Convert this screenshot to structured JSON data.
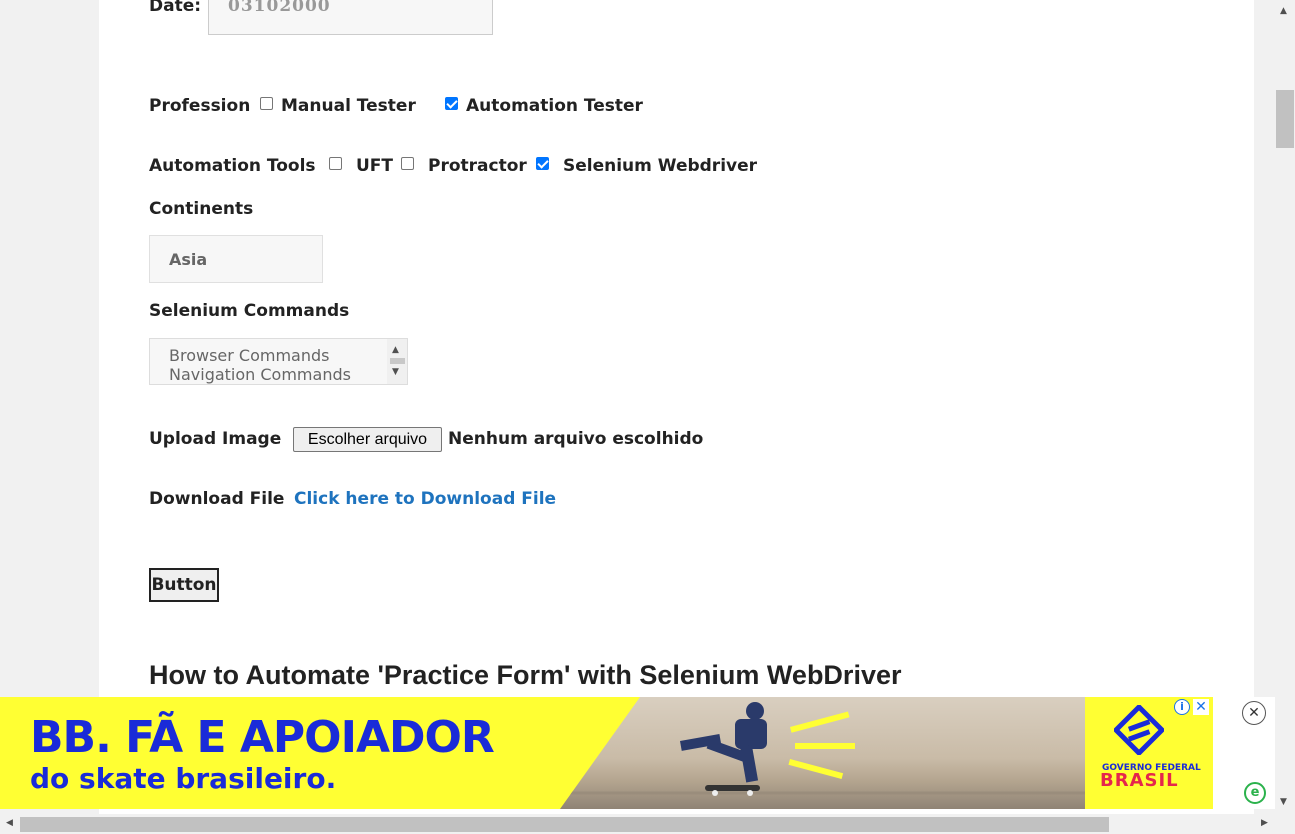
{
  "form": {
    "date_label": "Date:",
    "date_value": "03102000",
    "profession_label": "Profession",
    "profession_options": [
      {
        "label": "Manual Tester",
        "checked": false
      },
      {
        "label": "Automation Tester",
        "checked": true
      }
    ],
    "tools_label": "Automation Tools",
    "tools_options": [
      {
        "label": "UFT",
        "checked": false
      },
      {
        "label": "Protractor",
        "checked": false
      },
      {
        "label": "Selenium Webdriver",
        "checked": true
      }
    ],
    "continents_label": "Continents",
    "continents_value": "Asia",
    "commands_label": "Selenium Commands",
    "commands_items": [
      "Browser Commands",
      "Navigation Commands"
    ],
    "upload_label": "Upload Image",
    "upload_button": "Escolher arquivo",
    "upload_status": "Nenhum arquivo escolhido",
    "download_label": "Download File",
    "download_link": "Click here to Download File",
    "button_label": "Button"
  },
  "article": {
    "heading": "How to Automate 'Practice Form' with Selenium WebDriver"
  },
  "ad": {
    "headline": "BB. FÃ E APOIADOR",
    "subline": "do skate brasileiro.",
    "brand_top": "GOVERNO FEDERAL",
    "brand_main": "BRASIL",
    "info_icon": "info-icon",
    "close_icon": "close-icon"
  },
  "colors": {
    "link": "#1e73be",
    "ad_background": "#ffff33",
    "ad_text": "#1a2bd8",
    "checkbox_checked": "#0075ff"
  }
}
